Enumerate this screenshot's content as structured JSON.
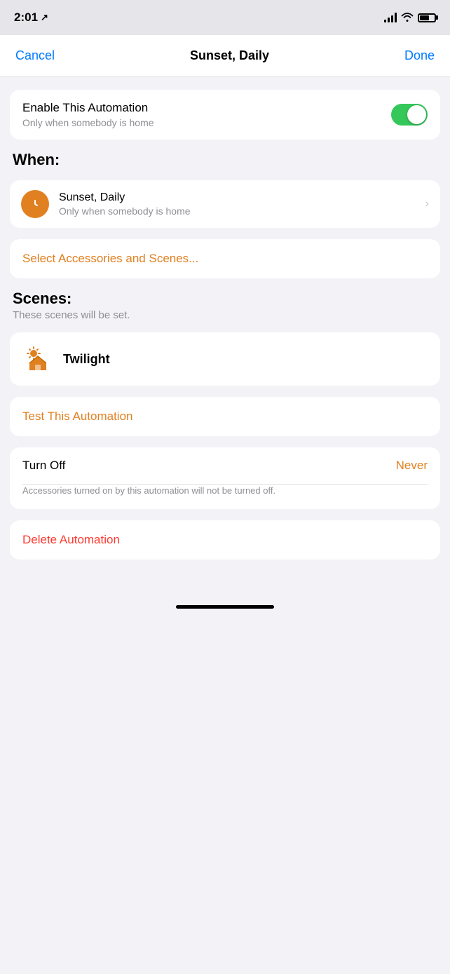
{
  "statusBar": {
    "time": "2:01",
    "hasLocationArrow": true
  },
  "navBar": {
    "cancelLabel": "Cancel",
    "title": "Sunset, Daily",
    "doneLabel": "Done"
  },
  "enableAutomation": {
    "label": "Enable This Automation",
    "sublabel": "Only when somebody is home",
    "toggleOn": true
  },
  "whenSection": {
    "header": "When:",
    "item": {
      "title": "Sunset, Daily",
      "subtitle": "Only when somebody is home"
    }
  },
  "selectAccessories": {
    "label": "Select Accessories and Scenes..."
  },
  "scenesSection": {
    "header": "Scenes:",
    "subheader": "These scenes will be set.",
    "items": [
      {
        "name": "Twilight",
        "icon": "🌅"
      }
    ]
  },
  "testAutomation": {
    "label": "Test This Automation"
  },
  "turnOff": {
    "label": "Turn Off",
    "value": "Never",
    "description": "Accessories turned on by this automation will not be turned off."
  },
  "deleteAutomation": {
    "label": "Delete Automation"
  },
  "icons": {
    "chevronRight": "›",
    "locationArrow": "↗"
  }
}
